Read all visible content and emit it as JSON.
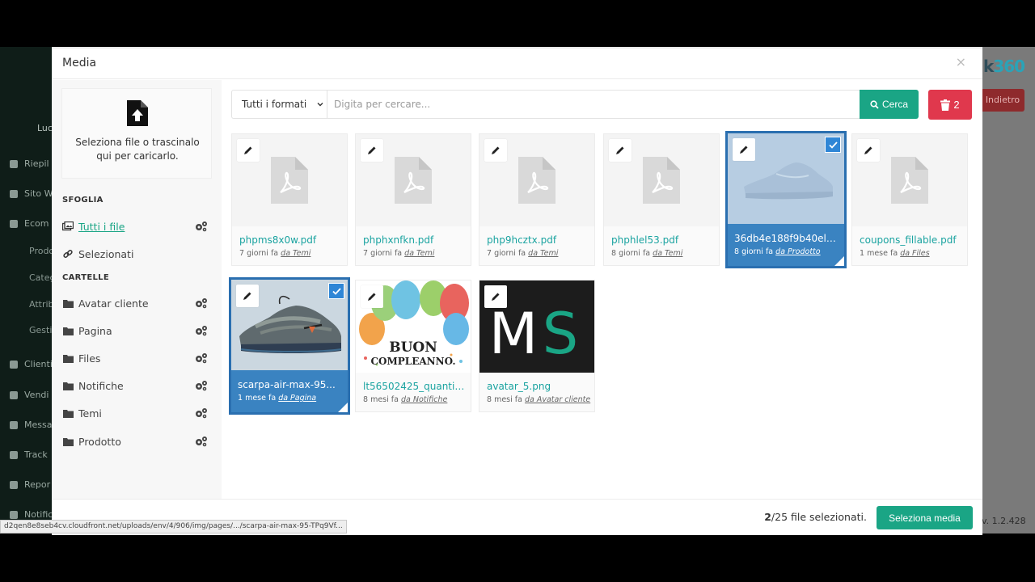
{
  "background": {
    "user": "Luc",
    "sidebar_items": [
      "Riepil",
      "Sito W",
      "Ecom",
      "Clienti",
      "Vendi",
      "Messa",
      "Track",
      "Repor",
      "Notific"
    ],
    "sidebar_subitems": [
      "Prodo",
      "Categ",
      "Attrib",
      "Gesti"
    ],
    "logo_text": "k",
    "logo_accent": "360",
    "back_button": "Indietro",
    "version": "v. 1.2.428"
  },
  "modal": {
    "title": "Media",
    "close_symbol": "×"
  },
  "upload": {
    "text": "Seleziona file o trascinalo qui per caricarlo."
  },
  "sidebar": {
    "browse_heading": "SFOGLIA",
    "browse_items": [
      {
        "label": "Tutti i file",
        "icon": "images-icon",
        "active": true,
        "has_settings": true
      },
      {
        "label": "Selezionati",
        "icon": "link-icon",
        "active": false,
        "has_settings": false
      }
    ],
    "folders_heading": "CARTELLE",
    "folders": [
      {
        "label": "Avatar cliente"
      },
      {
        "label": "Pagina"
      },
      {
        "label": "Files"
      },
      {
        "label": "Notifiche"
      },
      {
        "label": "Temi"
      },
      {
        "label": "Prodotto"
      }
    ]
  },
  "toolbar": {
    "format_select": "Tutti i formati",
    "search_placeholder": "Digita per cercare...",
    "search_button": "Cerca",
    "delete_count": "2"
  },
  "files": [
    {
      "name": "phpms8x0w.pdf",
      "age": "7 giorni fa",
      "source": "da Temi",
      "type": "pdf",
      "selected": false
    },
    {
      "name": "phphxnfkn.pdf",
      "age": "7 giorni fa",
      "source": "da Temi",
      "type": "pdf",
      "selected": false
    },
    {
      "name": "php9hcztx.pdf",
      "age": "7 giorni fa",
      "source": "da Temi",
      "type": "pdf",
      "selected": false
    },
    {
      "name": "phphlel53.pdf",
      "age": "8 giorni fa",
      "source": "da Temi",
      "type": "pdf",
      "selected": false
    },
    {
      "name": "36db4e188f9b40elb...",
      "age": "8 giorni fa",
      "source": "da Prodotto",
      "type": "sneaker-white",
      "selected": true
    },
    {
      "name": "coupons_fillable.pdf",
      "age": "1 mese fa",
      "source": "da Files",
      "type": "pdf",
      "selected": false
    },
    {
      "name": "scarpa-air-max-95...",
      "age": "1 mese fa",
      "source": "da Pagina",
      "type": "sneaker-grey",
      "selected": true
    },
    {
      "name": "lt56502425_quantiz...",
      "age": "8 mesi fa",
      "source": "da Notifiche",
      "type": "balloons",
      "selected": false,
      "image_text": [
        "BUON",
        "COMPLEANNO."
      ]
    },
    {
      "name": "avatar_5.png",
      "age": "8 mesi fa",
      "source": "da Avatar cliente",
      "type": "ms-logo",
      "selected": false,
      "image_text": [
        "M",
        "S"
      ]
    }
  ],
  "footer": {
    "selected_count": "2",
    "total_text": "/25 file selezionati.",
    "select_button": "Seleziona media"
  },
  "status_url": "d2qen8e8seb4cv.cloudfront.net/uploads/env/4/906/img/pages/.../scarpa-air-max-95-TPq9Vf...",
  "colors": {
    "accent": "#1aa585",
    "danger": "#e0384d",
    "selected": "#3a83c1",
    "link": "#1aa3a0"
  }
}
